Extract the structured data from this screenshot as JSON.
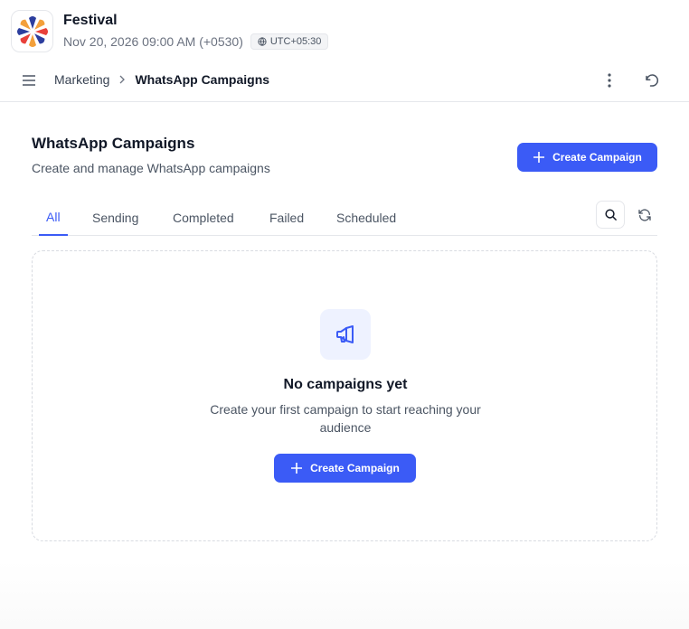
{
  "event": {
    "name": "Festival",
    "datetime": "Nov 20, 2026 09:00 AM (+0530)",
    "timezone": "UTC+05:30"
  },
  "breadcrumb": {
    "parent": "Marketing",
    "current": "WhatsApp Campaigns"
  },
  "page": {
    "title": "WhatsApp Campaigns",
    "subtitle": "Create and manage WhatsApp campaigns",
    "create_label": "Create Campaign"
  },
  "tabs": [
    {
      "label": "All",
      "active": true
    },
    {
      "label": "Sending",
      "active": false
    },
    {
      "label": "Completed",
      "active": false
    },
    {
      "label": "Failed",
      "active": false
    },
    {
      "label": "Scheduled",
      "active": false
    }
  ],
  "empty_state": {
    "icon": "megaphone-icon",
    "title": "No campaigns yet",
    "description": "Create your first campaign to start reaching your audience",
    "button_label": "Create Campaign"
  },
  "colors": {
    "primary": "#3b5bf6",
    "icon_bg": "#eef2ff",
    "text_dark": "#111827",
    "text_muted": "#4b5563"
  }
}
